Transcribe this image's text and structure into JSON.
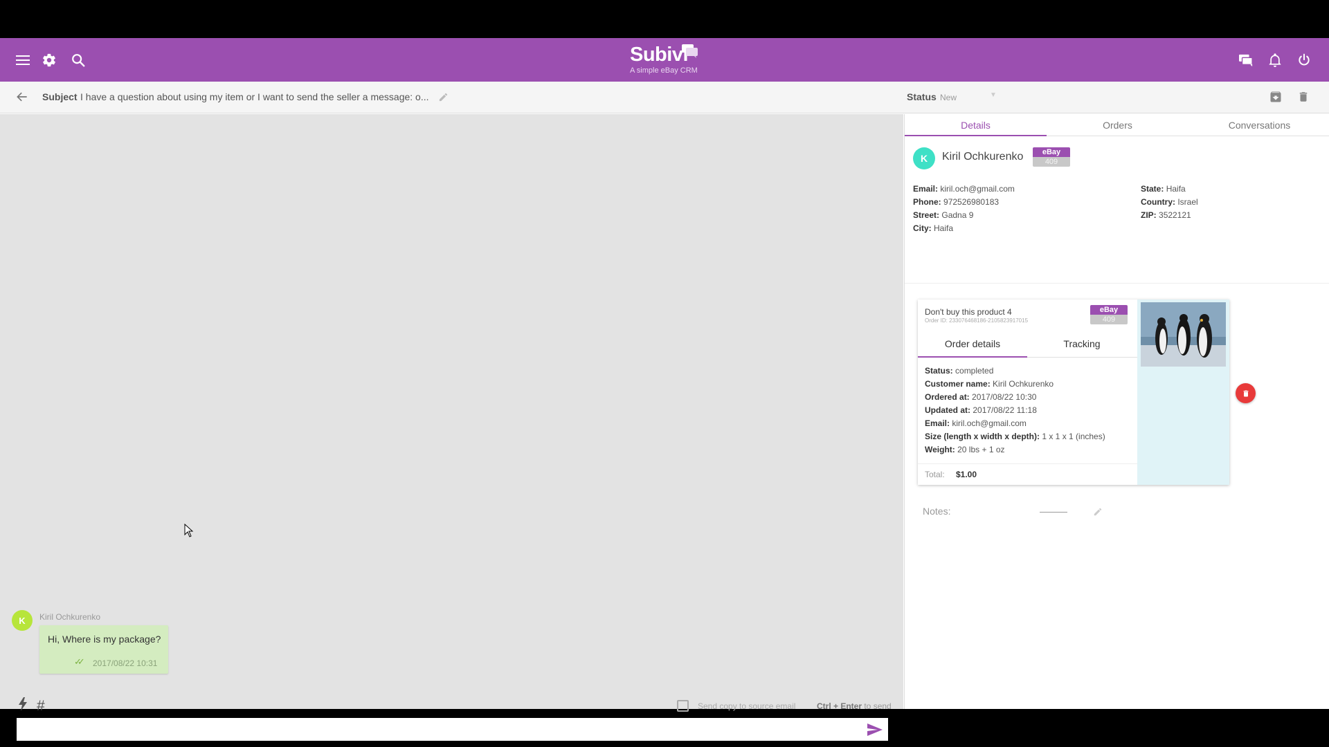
{
  "header": {
    "brand_name": "Subivi",
    "brand_tagline": "A simple eBay CRM",
    "brand_color": "#9b4fb0",
    "icons": [
      "menu-icon",
      "settings-icon",
      "search-icon",
      "chat-icon",
      "bell-icon",
      "power-icon"
    ]
  },
  "subject_bar": {
    "subject_label": "Subject",
    "subject_text": "I have a question about using my item or I want to send the seller a message: o...",
    "status_label": "Status",
    "status_value": "New"
  },
  "chat": {
    "message": {
      "author": "Kiril Ochkurenko",
      "avatar_letter": "K",
      "text": "Hi, Where is my package?",
      "time": "2017/08/22 10:31"
    },
    "copy_label": "Send copy to source email",
    "send_hint_keys": "Ctrl + Enter",
    "send_hint_rest": " to send",
    "input_placeholder": ""
  },
  "panel": {
    "tabs": [
      "Details",
      "Orders",
      "Conversations"
    ],
    "customer": {
      "avatar_letter": "K",
      "name": "Kiril Ochkurenko",
      "badge_top": "eBay",
      "badge_bottom": "409",
      "left_fields": [
        {
          "label": "Email:",
          "value": "kiril.och@gmail.com"
        },
        {
          "label": "Phone:",
          "value": "972526980183"
        },
        {
          "label": "Street:",
          "value": "Gadna 9"
        },
        {
          "label": "City:",
          "value": "Haifa"
        }
      ],
      "right_fields": [
        {
          "label": "State:",
          "value": "Haifa"
        },
        {
          "label": "Country:",
          "value": "Israel"
        },
        {
          "label": "ZIP:",
          "value": "3522121"
        }
      ]
    },
    "order": {
      "title": "Don't buy this product 4",
      "order_id": "Order ID: 233076468186-2105823917015",
      "badge_top": "eBay",
      "badge_bottom": "409",
      "tabs": [
        "Order details",
        "Tracking"
      ],
      "fields": [
        {
          "label": "Status:",
          "value": "completed"
        },
        {
          "label": "Customer name:",
          "value": "Kiril Ochkurenko"
        },
        {
          "label": "Ordered at:",
          "value": "2017/08/22 10:30"
        },
        {
          "label": "Updated at:",
          "value": "2017/08/22 11:18"
        },
        {
          "label": "Email:",
          "value": "kiril.och@gmail.com"
        },
        {
          "label": "Size (length x width x depth):",
          "value": "1 x 1 x 1 (inches)"
        },
        {
          "label": "Weight:",
          "value": "20 lbs + 1 oz"
        }
      ],
      "total_label": "Total:",
      "total_value": "$1.00"
    },
    "notes_label": "Notes:"
  }
}
